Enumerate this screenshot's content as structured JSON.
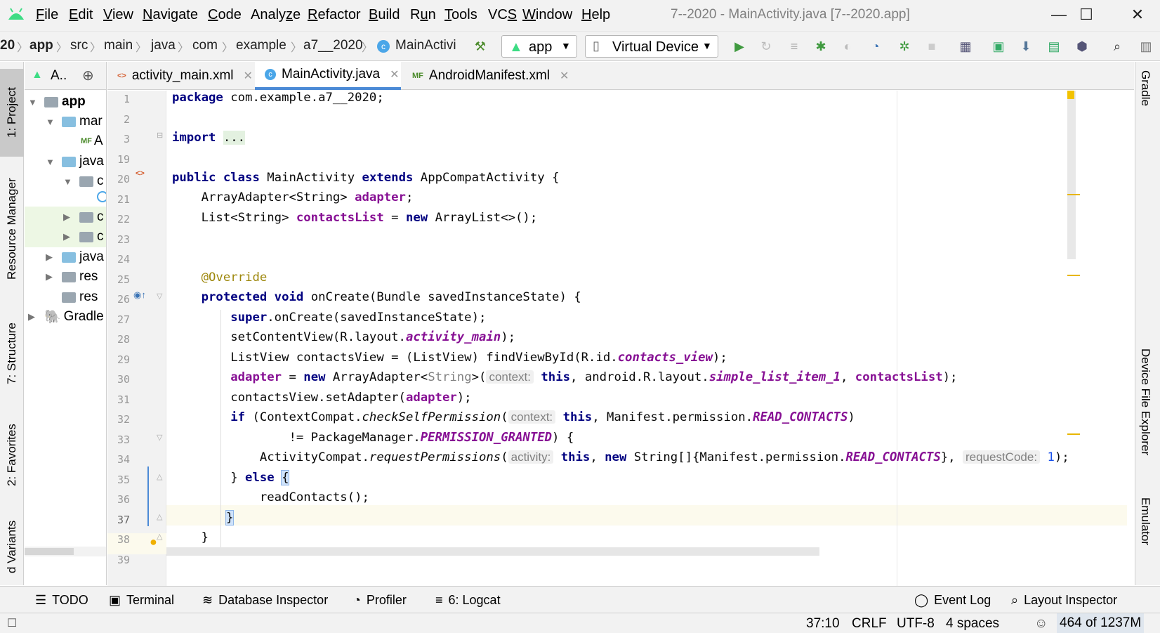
{
  "menu": {
    "items": [
      "File",
      "Edit",
      "View",
      "Navigate",
      "Code",
      "Analyze",
      "Refactor",
      "Build",
      "Run",
      "Tools",
      "VCS",
      "Window",
      "Help"
    ],
    "underline": [
      "F",
      "E",
      "V",
      "N",
      "C",
      "z",
      "R",
      "B",
      "u",
      "T",
      "S",
      "W",
      "H"
    ]
  },
  "window": {
    "title": "7--2020 - MainActivity.java [7--2020.app]"
  },
  "breadcrumb": {
    "items": [
      "20",
      "app",
      "src",
      "main",
      "java",
      "com",
      "example",
      "a7__2020",
      "MainActivi"
    ]
  },
  "toolbar": {
    "run_config": "app",
    "device": "Virtual Device"
  },
  "left_tabs": {
    "project": "1: Project",
    "resource_manager": "Resource Manager",
    "structure": "7: Structure",
    "favorites": "2: Favorites",
    "build_variants": "d Variants"
  },
  "project_panel": {
    "title": "A..",
    "tree": [
      "app",
      "mar",
      "A",
      "java",
      "c",
      "c",
      "c",
      "java",
      "res",
      "res",
      "Gradle"
    ]
  },
  "tabs": [
    {
      "label": "activity_main.xml",
      "close": "✕"
    },
    {
      "label": "MainActivity.java",
      "close": "✕"
    },
    {
      "label": "AndroidManifest.xml",
      "close": "✕"
    }
  ],
  "editor": {
    "line_numbers": [
      "1",
      "2",
      "3",
      "19",
      "20",
      "21",
      "22",
      "23",
      "24",
      "25",
      "26",
      "27",
      "28",
      "29",
      "30",
      "31",
      "32",
      "33",
      "34",
      "35",
      "36",
      "37",
      "38",
      "39"
    ],
    "tokens": {
      "package_kw": "package",
      "package_name": " com.example.a7__2020;",
      "import_kw": "import",
      "import_dots": "...",
      "public_kw": "public",
      "class_kw": "class",
      "class_name": " MainActivity ",
      "extends_kw": "extends",
      "super_class": " AppCompatActivity {",
      "l21_type": "    ArrayAdapter<String> ",
      "l21_field": "adapter",
      "l21_end": ";",
      "l22_type": "    List<String> ",
      "l22_field": "contactsList",
      "l22_eq": " = ",
      "l22_new": "new",
      "l22_end": " ArrayList<>();",
      "annotation": "    @Override",
      "protected_kw": "protected",
      "void_kw": "void",
      "l26_rest": " onCreate(Bundle savedInstanceState) {",
      "super_kw": "super",
      "l27_rest": ".onCreate(savedInstanceState);",
      "l28_a": "        setContentView(R.layout.",
      "l28_it": "activity_main",
      "l28_b": ");",
      "l29_a": "        ListView contactsView = (ListView) findViewById(R.id.",
      "l29_it": "contacts_view",
      "l29_b": ");",
      "l30_field": "adapter",
      "l30_eq": " = ",
      "l30_new": "new",
      "l30_a": " ArrayAdapter<",
      "l30_gen": "String",
      "l30_b": ">(",
      "hint_context": "context:",
      "this_kw": "this",
      "l30_c": ", android.R.layout.",
      "l30_it": "simple_list_item_1",
      "l30_d": ", ",
      "l30_field2": "contactsList",
      "l30_e": ");",
      "l31_a": "        contactsView.setAdapter(",
      "l31_field": "adapter",
      "l31_b": ");",
      "if_kw": "if",
      "l32_a": " (ContextCompat.",
      "l32_it": "checkSelfPermission",
      "l32_b": "(",
      "l32_c": ", Manifest.permission.",
      "l32_it2": "READ_CONTACTS",
      "l32_d": ")",
      "l33_a": "                != PackageManager.",
      "l33_it": "PERMISSION_GRANTED",
      "l33_b": ") {",
      "l34_a": "            ActivityCompat.",
      "l34_it": "requestPermissions",
      "l34_b": "(",
      "hint_activity": "activity:",
      "l34_c": ", ",
      "l34_new": "new",
      "l34_d": " String[]{Manifest.permission.",
      "l34_it2": "READ_CONTACTS",
      "l34_e": "}, ",
      "hint_request": "requestCode:",
      "l34_num": "1",
      "l34_f": ");",
      "l35_a": "        } ",
      "else_kw": "else",
      "l35_b": "{",
      "l36": "            readContacts();",
      "l37": "}",
      "l38": "    }"
    }
  },
  "right_tabs": {
    "gradle": "Gradle",
    "device_file_explorer": "Device File Explorer",
    "emulator": "Emulator"
  },
  "bottom_tabs": {
    "todo": "TODO",
    "terminal": "Terminal",
    "database": "Database Inspector",
    "profiler": "Profiler",
    "logcat": "6: Logcat",
    "event_log": "Event Log",
    "layout_inspector": "Layout Inspector"
  },
  "status": {
    "position": "37:10",
    "line_sep": "CRLF",
    "encoding": "UTF-8",
    "indent": "4 spaces",
    "memory": "464 of 1237M"
  },
  "colors": {
    "keyword": "#0033b3",
    "field": "#871094",
    "annotation": "#9e880d",
    "caret_line": "#fcfaed",
    "accent": "#4b8ad6"
  }
}
